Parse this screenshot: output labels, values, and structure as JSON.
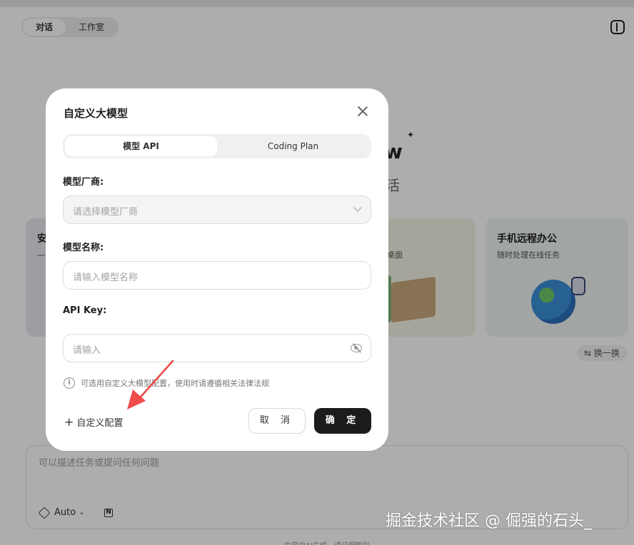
{
  "app": {
    "mode_tabs": [
      {
        "label": "对话",
        "active": true
      },
      {
        "label": "工作室",
        "active": false
      }
    ],
    "hero_suffix": "w",
    "hero_sub_suffix": "活",
    "cards": [
      {
        "title": "安",
        "desc": "一"
      },
      {
        "title": "",
        "desc": "桌面"
      },
      {
        "title": "手机远程办公",
        "desc": "随时处理在线任务"
      }
    ],
    "swap_label": "换一换",
    "composer": {
      "placeholder": "可以描述任务或提问任何问题",
      "model": "Auto"
    },
    "footer_note": "内容由AI生成，请仔细甄别"
  },
  "modal": {
    "title": "自定义大模型",
    "tabs": [
      {
        "label": "模型 API",
        "active": true
      },
      {
        "label": "Coding Plan",
        "active": false
      }
    ],
    "vendor": {
      "label": "模型厂商:",
      "placeholder": "请选择模型厂商"
    },
    "model_name": {
      "label": "模型名称:",
      "placeholder": "请输入模型名称"
    },
    "api_key": {
      "label": "API Key:",
      "placeholder": "请输入"
    },
    "hint": "可选用自定义大模型配置，使用时请遵循相关法律法规",
    "custom_config_label": "自定义配置",
    "cancel_label": "取 消",
    "ok_label": "确 定"
  },
  "annotation": {
    "arrow_color": "#ee4b4b"
  },
  "watermark": "掘金技术社区 @ 倔强的石头_"
}
